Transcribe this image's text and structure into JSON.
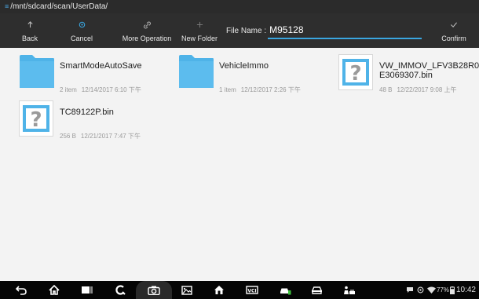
{
  "path": {
    "menu_glyph": "≡",
    "text": "/mnt/sdcard/scan/UserData/"
  },
  "toolbar": {
    "back_label": "Back",
    "cancel_label": "Cancel",
    "more_label": "More Operation",
    "new_folder_label": "New Folder",
    "file_name_label": "File Name :",
    "file_name_value": "M95128",
    "confirm_label": "Confirm",
    "accent": "#3aa6e0"
  },
  "files": [
    {
      "type": "folder",
      "name": "SmartModeAutoSave",
      "size": "2 item",
      "date": "12/14/2017 6:10 下午"
    },
    {
      "type": "folder",
      "name": "VehicleImmo",
      "size": "1 item",
      "date": "12/12/2017 2:26 下午"
    },
    {
      "type": "unknown-file",
      "name": "VW_IMMOV_LFV3B28R0E3069307.bin",
      "size": "48 B",
      "date": "12/22/2017 9:08 上午"
    },
    {
      "type": "unknown-file",
      "name": "TC89122P.bin",
      "size": "256 B",
      "date": "12/21/2017 7:47 下午"
    }
  ],
  "status": {
    "battery": "77%",
    "time": "10:42"
  },
  "colors": {
    "folder": "#4fb3e8",
    "toolbar_bg": "#2e2e2e",
    "content_bg": "#f3f3f3"
  }
}
